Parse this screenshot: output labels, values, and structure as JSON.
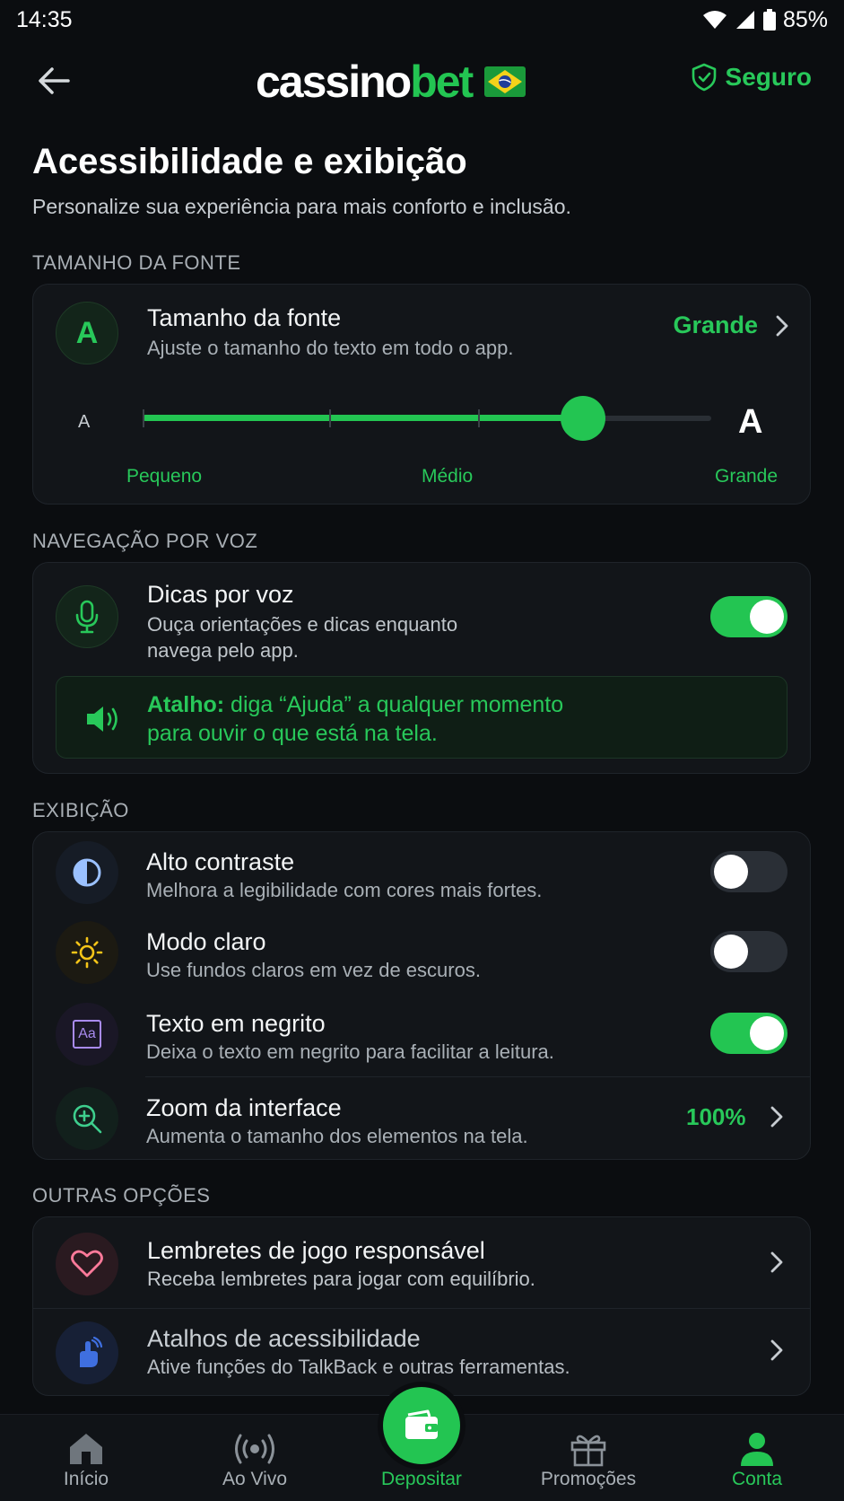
{
  "status": {
    "time": "14:35",
    "battery": "85%"
  },
  "header": {
    "logo_part1": "cassino",
    "logo_part2": "bet",
    "secure_label": "Seguro"
  },
  "page": {
    "title": "Acessibilidade e exibição",
    "subtitle": "Personalize sua experiência para mais conforto e inclusão."
  },
  "font_section": {
    "label": "TAMANHO DA FONTE",
    "icon_letter": "A",
    "title": "Tamanho da fonte",
    "subtitle": "Ajuste o tamanho do texto em todo o app.",
    "value": "Grande",
    "slider_small": "A",
    "slider_large": "A",
    "slider_level": 0.78,
    "slider_labels": [
      "Pequeno",
      "Médio",
      "Grande"
    ]
  },
  "voice_section": {
    "label": "NAVEGAÇÃO POR VOZ",
    "title": "Dicas por voz",
    "subtitle_line1": "Ouça orientações e dicas enquanto",
    "subtitle_line2": "navega pelo app.",
    "toggle_on": true,
    "tip_bold": "Atalho:",
    "tip_line1": " diga “Ajuda” a qualquer momento",
    "tip_line2": "para ouvir o que está na tela."
  },
  "display_section": {
    "label": "EXIBIÇÃO",
    "items": [
      {
        "title": "Alto contraste",
        "subtitle": "Melhora a legibilidade com cores mais fortes.",
        "toggle_on": false,
        "icon": "contrast-icon"
      },
      {
        "title": "Modo claro",
        "subtitle": "Use fundos claros em vez de escuros.",
        "toggle_on": false,
        "icon": "sun-icon"
      },
      {
        "title": "Texto em negrito",
        "subtitle": "Deixa o texto em negrito para facilitar a leitura.",
        "toggle_on": true,
        "icon": "text-format-icon",
        "icon_text": "Aa"
      },
      {
        "title": "Zoom da interface",
        "subtitle": "Aumenta o tamanho dos elementos na tela.",
        "value": "100%",
        "icon": "zoom-icon"
      }
    ]
  },
  "other_section": {
    "label": "OUTRAS OPÇÕES",
    "items": [
      {
        "title": "Lembretes de jogo responsável",
        "subtitle": "Receba lembretes para jogar com equilíbrio.",
        "icon": "heart-icon"
      },
      {
        "title": "Atalhos de acessibilidade",
        "subtitle": "Ative funções do TalkBack e outras ferramentas.",
        "icon": "hand-gesture-icon"
      }
    ]
  },
  "bottom_nav": {
    "items": [
      {
        "label": "Início",
        "icon": "home-icon"
      },
      {
        "label": "Ao Vivo",
        "icon": "live-broadcast-icon"
      },
      {
        "label": "Depositar",
        "icon": "wallet-icon"
      },
      {
        "label": "Promoções",
        "icon": "gift-icon"
      },
      {
        "label": "Conta",
        "icon": "user-icon",
        "active": true
      }
    ]
  },
  "colors": {
    "accent": "#23c552",
    "background": "#0b0d10",
    "card": "#121519"
  }
}
